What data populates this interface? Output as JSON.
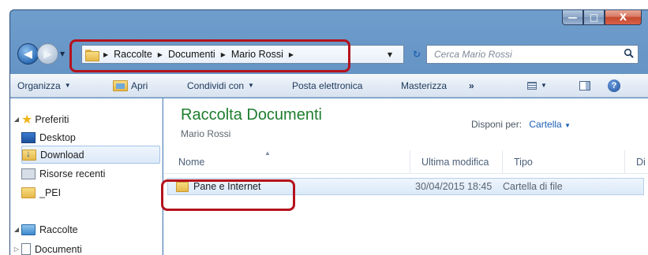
{
  "window": {
    "minimize_glyph": "—",
    "maximize_glyph": "□",
    "close_glyph": "X"
  },
  "address_bar": {
    "breadcrumbs": [
      "Raccolte",
      "Documenti",
      "Mario Rossi"
    ]
  },
  "search": {
    "placeholder": "Cerca Mario Rossi"
  },
  "toolbar": {
    "organize": "Organizza",
    "open": "Apri",
    "share": "Condividi con",
    "email": "Posta elettronica",
    "burn": "Masterizza",
    "more": "»"
  },
  "nav_pane": {
    "favorites_header": "Preferiti",
    "favorites": [
      {
        "label": "Desktop",
        "icon": "desktop-icon"
      },
      {
        "label": "Download",
        "icon": "download-folder-icon",
        "selected": true
      },
      {
        "label": "Risorse recenti",
        "icon": "recent-places-icon"
      },
      {
        "label": "_PEI",
        "icon": "folder-icon"
      }
    ],
    "libraries_header": "Raccolte",
    "libraries": [
      {
        "label": "Documenti",
        "icon": "documents-icon"
      }
    ]
  },
  "library": {
    "title": "Raccolta Documenti",
    "subtitle": "Mario Rossi",
    "arrange_label": "Disponi per:",
    "arrange_value": "Cartella"
  },
  "columns": [
    "Nome",
    "Ultima modifica",
    "Tipo",
    "Di"
  ],
  "rows": [
    {
      "name": "Pane e Internet",
      "modified": "30/04/2015 18:45",
      "type": "Cartella di file"
    }
  ],
  "colors": {
    "highlight": "#b4121d",
    "library_title": "#1e7e2e",
    "link": "#1c5fb4"
  }
}
